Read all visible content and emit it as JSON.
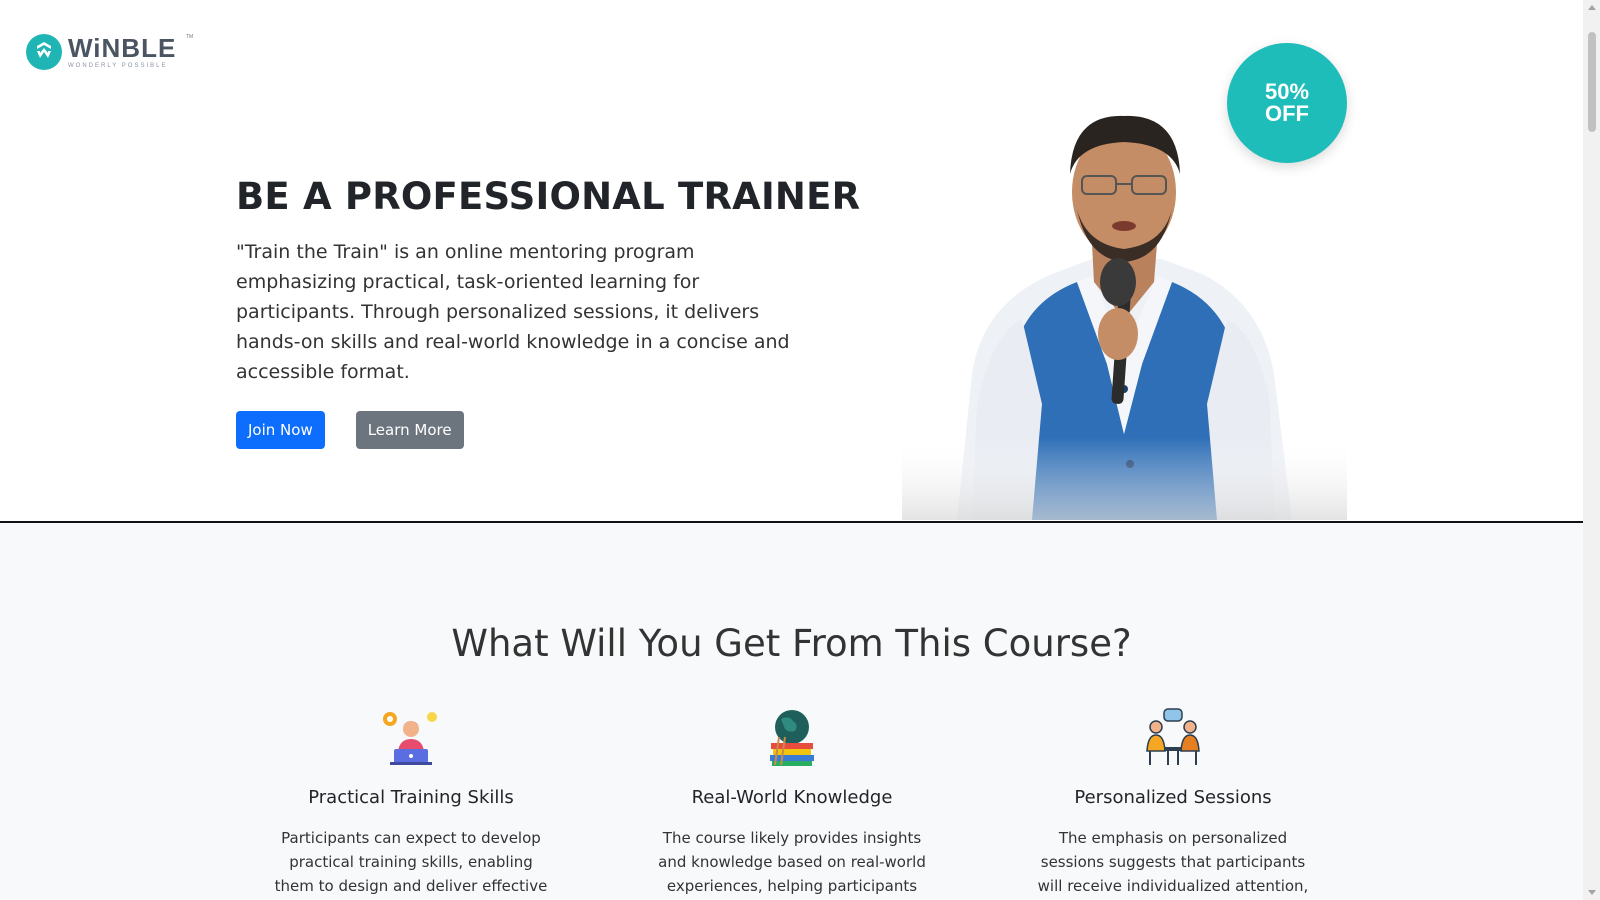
{
  "brand": {
    "name": "WiNBLE",
    "tagline": "WONDERLY POSSIBLE",
    "trademark": "TM",
    "accent_color": "#1fb5b5"
  },
  "hero": {
    "title": "BE A PROFESSIONAL TRAINER",
    "description": "\"Train the Train\" is an online mentoring program emphasizing practical, task-oriented learning for participants. Through personalized sessions, it delivers hands-on skills and real-world knowledge in a concise and accessible format.",
    "join_label": "Join Now",
    "learn_label": "Learn More",
    "badge_line1": "50%",
    "badge_line2": "OFF",
    "image_alt": "trainer-speaking-with-microphone"
  },
  "features": {
    "title": "What Will You Get From This Course?",
    "items": [
      {
        "icon": "trainer-laptop-icon",
        "title": "Practical Training Skills",
        "description": "Participants can expect to develop practical training skills, enabling them to design and deliver effective training"
      },
      {
        "icon": "globe-books-icon",
        "title": "Real-World Knowledge",
        "description": "The course likely provides insights and knowledge based on real-world experiences, helping participants"
      },
      {
        "icon": "conversation-icon",
        "title": "Personalized Sessions",
        "description": "The emphasis on personalized sessions suggests that participants will receive individualized attention, allowing for"
      }
    ]
  },
  "colors": {
    "primary": "#0d6efd",
    "secondary": "#6c757d",
    "badge": "#1ebdba"
  }
}
